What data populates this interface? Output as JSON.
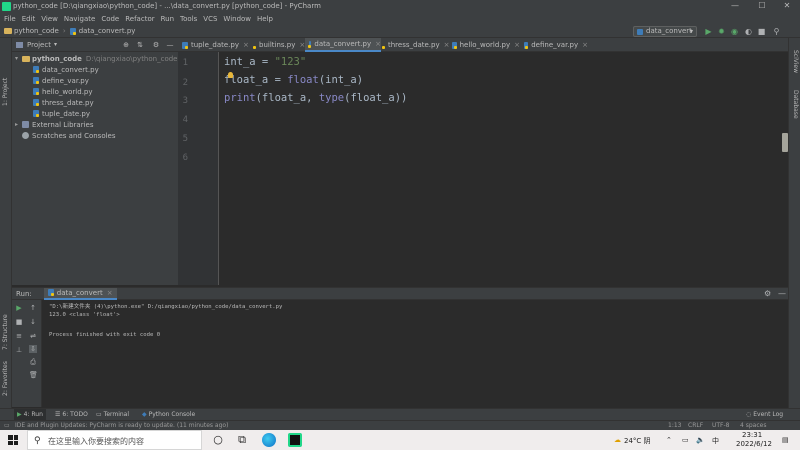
{
  "window": {
    "title": "python_code [D:\\qiangxiao\\python_code] - ...\\data_convert.py [python_code] - PyCharm",
    "minimize": "—",
    "maximize": "☐",
    "close": "✕"
  },
  "menu": [
    "File",
    "Edit",
    "View",
    "Navigate",
    "Code",
    "Refactor",
    "Run",
    "Tools",
    "VCS",
    "Window",
    "Help"
  ],
  "breadcrumb": {
    "project": "python_code",
    "file": "data_convert.py"
  },
  "run_config": {
    "name": "data_convert"
  },
  "left_stripe": {
    "project_label": "1: Project",
    "structure_label": "7: Structure",
    "favorites_label": "2: Favorites"
  },
  "right_stripe": {
    "scview_label": "SciView",
    "database_label": "Database"
  },
  "project_panel": {
    "header": "Project",
    "root": {
      "name": "python_code",
      "path": "D:\\qiangxiao\\python_code"
    },
    "files": [
      "data_convert.py",
      "define_var.py",
      "hello_world.py",
      "thress_date.py",
      "tuple_date.py"
    ],
    "external": "External Libraries",
    "scratches": "Scratches and Consoles"
  },
  "tabs": [
    {
      "label": "tuple_date.py",
      "active": false
    },
    {
      "label": "builtins.py",
      "active": false
    },
    {
      "label": "data_convert.py",
      "active": true
    },
    {
      "label": "thress_date.py",
      "active": false
    },
    {
      "label": "hello_world.py",
      "active": false
    },
    {
      "label": "define_var.py",
      "active": false
    }
  ],
  "line_numbers": [
    "1",
    "2",
    "3",
    "4",
    "5",
    "6"
  ],
  "code": {
    "l1_a": "int_a = ",
    "l1_str": "\"123\"",
    "l2_a": "float_a = ",
    "l2_fn": "float",
    "l2_b": "(int_a)",
    "l3_fn": "print",
    "l3_a": "(float_a, ",
    "l3_fn2": "type",
    "l3_b": "(float_a))"
  },
  "run_panel": {
    "label": "Run:",
    "tab": "data_convert",
    "lines": [
      "\"D:\\新建文件夹 (4)\\python.exe\" D:/qiangxiao/python_code/data_convert.py",
      "123.0 <class 'float'>",
      "",
      "Process finished with exit code 0"
    ]
  },
  "bottom_tabs": [
    "4: Run",
    "6: TODO",
    "Terminal",
    "Python Console"
  ],
  "event_log": "Event Log",
  "status": {
    "message": "IDE and Plugin Updates: PyCharm is ready to update. (11 minutes ago)",
    "position": "1:13",
    "line_sep": "CRLF",
    "encoding": "UTF-8",
    "indent": "4 spaces"
  },
  "taskbar": {
    "search_placeholder": "在这里输入你要搜索的内容",
    "weather": "24°C 阴",
    "time": "23:31",
    "date": "2022/6/12"
  },
  "colors": {
    "accent": "#4a88c7",
    "string": "#6a8759",
    "builtin": "#8888c6",
    "code": "#a9b7c6"
  }
}
